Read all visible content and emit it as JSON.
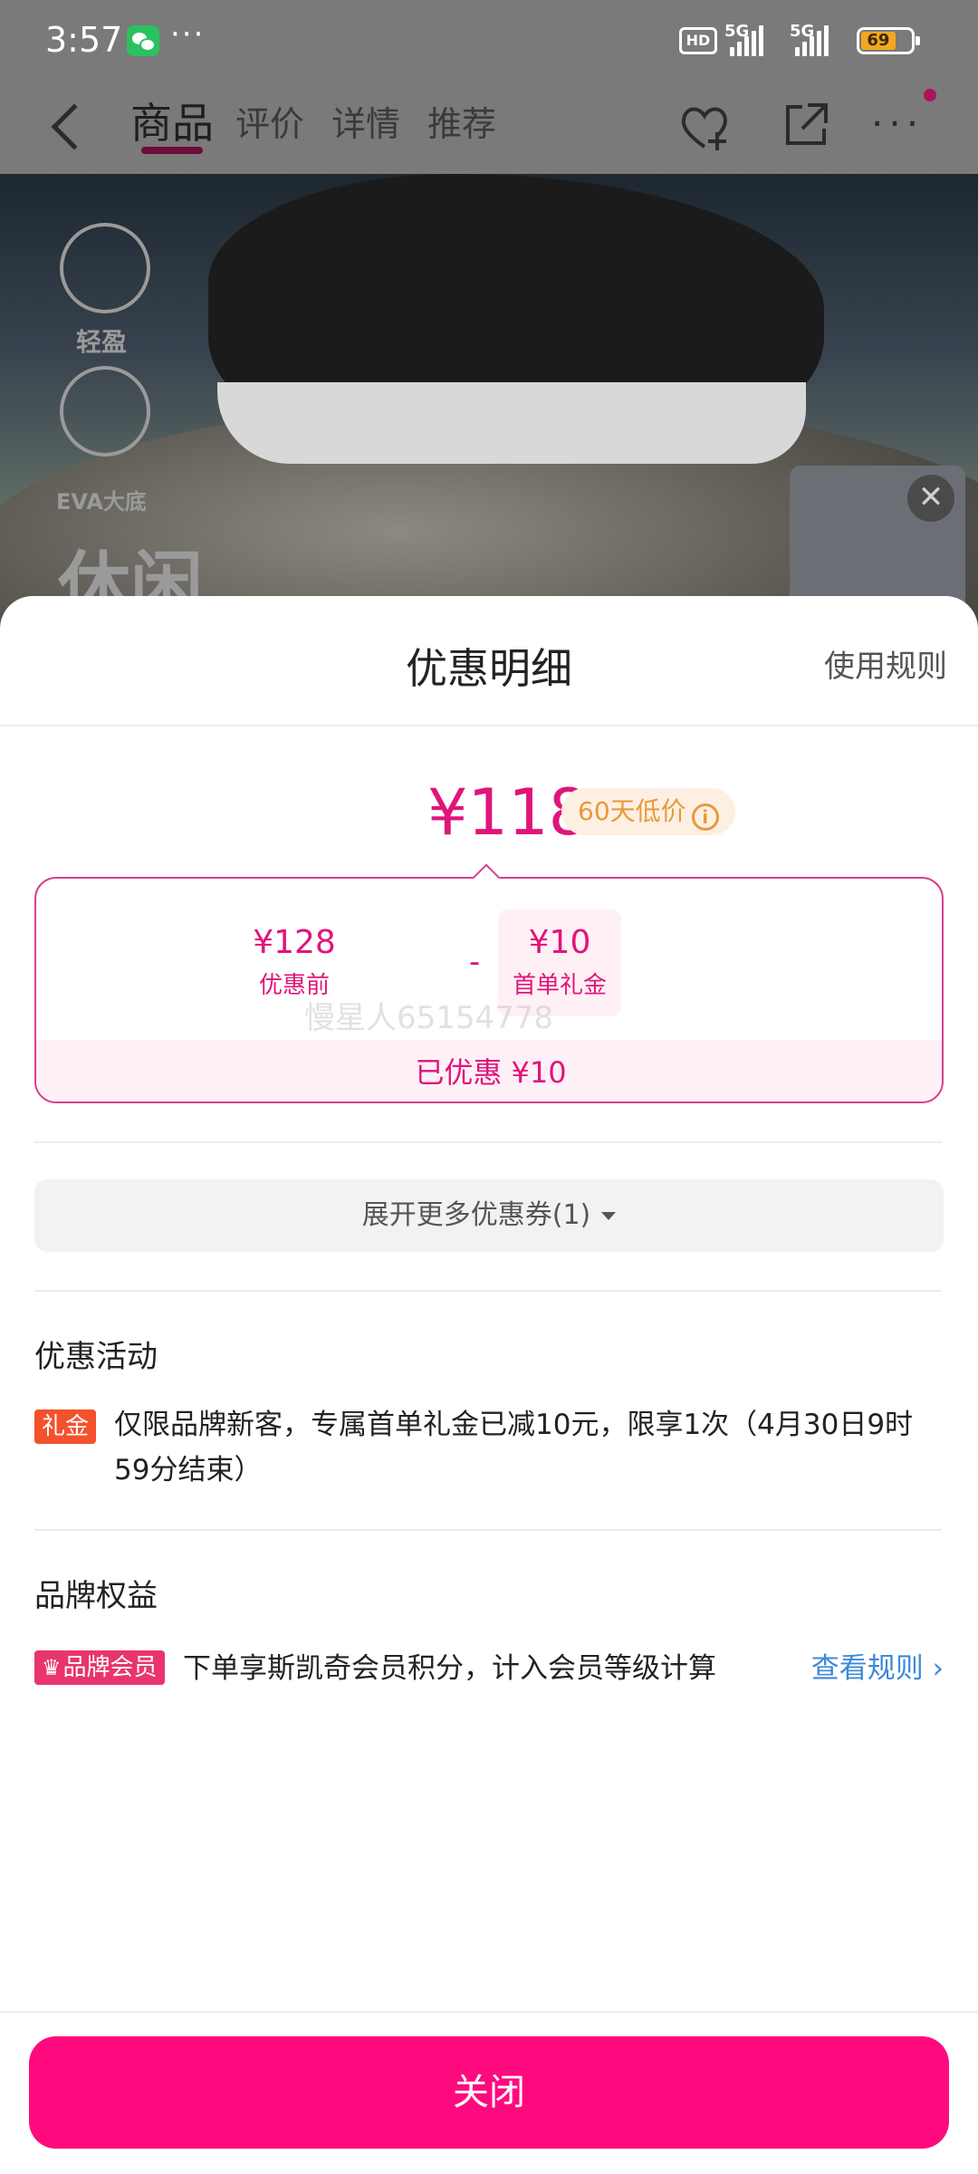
{
  "status_bar": {
    "time": "3:57",
    "dots": "···",
    "hd_label": "HD",
    "network_1": "5G",
    "network_2": "5G",
    "battery": "69"
  },
  "nav": {
    "tabs": [
      {
        "label": "商品",
        "active": true
      },
      {
        "label": "评价",
        "active": false
      },
      {
        "label": "详情",
        "active": false
      },
      {
        "label": "推荐",
        "active": false
      }
    ],
    "more": "···"
  },
  "hero": {
    "badge_1": "轻盈",
    "badge_2": "EVA大底",
    "headline": "休闲",
    "thumb_close": "✕"
  },
  "sheet": {
    "title": "优惠明细",
    "rules_link": "使用规则",
    "final_price": "¥118",
    "low_price_badge": "60天低价",
    "info_glyph": "i",
    "original_amount": "¥128",
    "original_label": "优惠前",
    "minus": "-",
    "coupon_amount": "¥10",
    "coupon_label": "首单礼金",
    "watermark": "慢星人65154778",
    "saved_text": "已优惠 ¥10",
    "expand_label": "展开更多优惠券(1)",
    "activities_title": "优惠活动",
    "gift_tag": "礼金",
    "gift_desc": "仅限品牌新客，专属首单礼金已减10元，限享1次（4月30日9时59分结束）",
    "benefits_title": "品牌权益",
    "member_tag": "品牌会员",
    "member_desc": "下单享斯凯奇会员积分，计入会员等级计算",
    "view_rules": "查看规则 ›",
    "close_label": "关闭"
  },
  "colors": {
    "accent": "#e0157a",
    "close_button": "#ff0a7e",
    "gift_tag": "#f4512c",
    "member_tag": "#e8356d",
    "link": "#3d8ad6"
  }
}
